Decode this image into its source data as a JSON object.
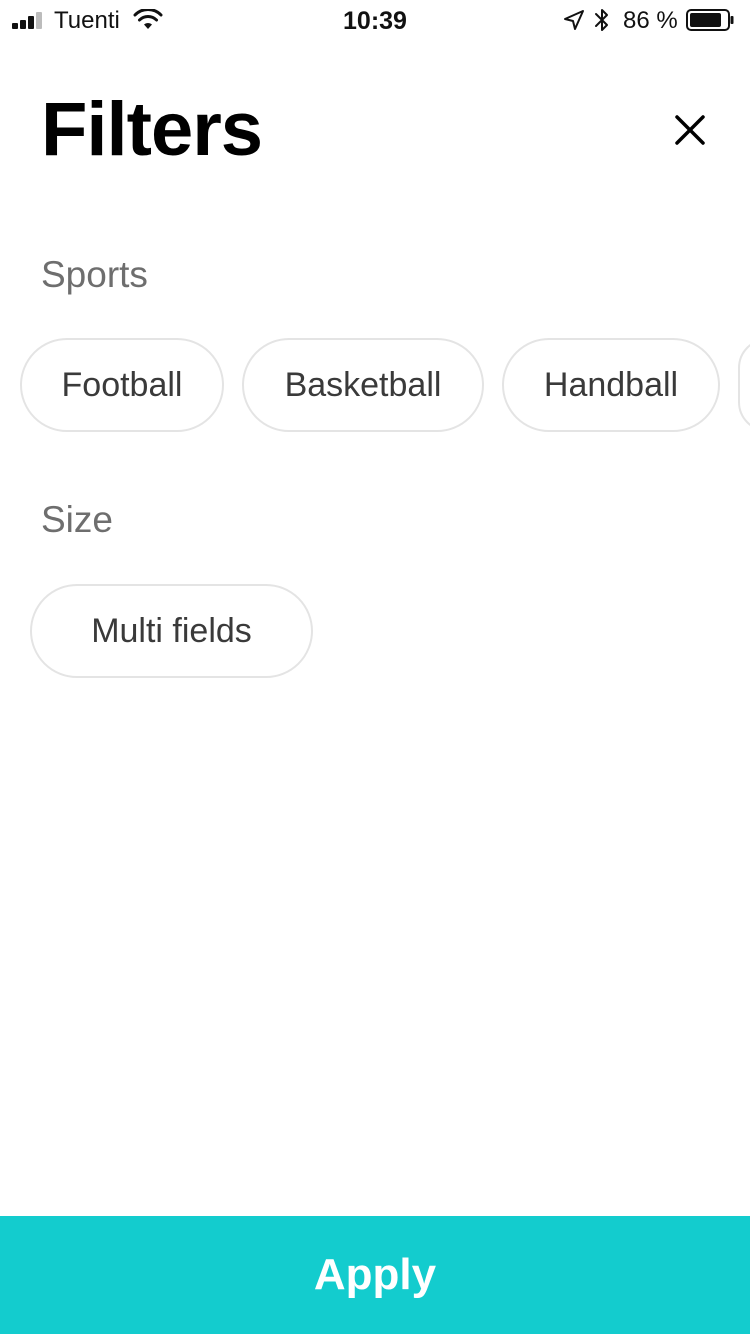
{
  "status_bar": {
    "carrier": "Tuenti",
    "time": "10:39",
    "battery_percent": "86 %",
    "battery_level": 0.86,
    "signal_bars": 3,
    "icons": [
      "signal-icon",
      "wifi-icon",
      "location-arrow-icon",
      "bluetooth-icon",
      "battery-icon"
    ]
  },
  "header": {
    "title": "Filters",
    "close_icon": "close-icon"
  },
  "sections": {
    "sports": {
      "title": "Sports",
      "chips": [
        "Football",
        "Basketball",
        "Handball"
      ]
    },
    "size": {
      "title": "Size",
      "chips": [
        "Multi fields"
      ]
    }
  },
  "footer": {
    "apply_label": "Apply"
  },
  "colors": {
    "accent": "#13ccce",
    "chip_border": "#e4e4e4",
    "section_title": "#6e6e6e",
    "chip_text": "#3a3a3a"
  }
}
